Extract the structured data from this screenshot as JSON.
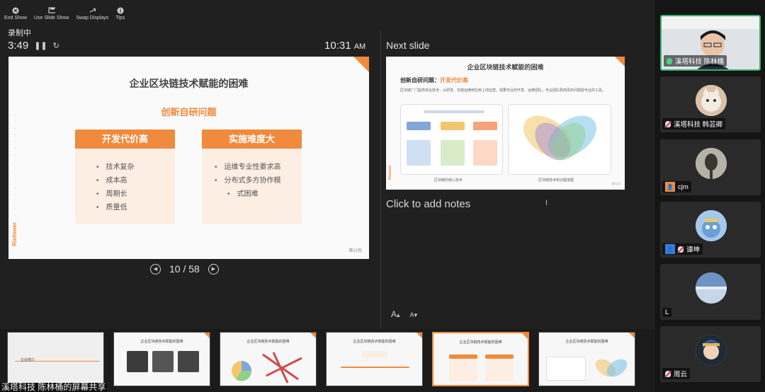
{
  "toolbar": {
    "items": [
      {
        "label": "End Show",
        "icon": "close-circle-icon"
      },
      {
        "label": "Use Slide Show",
        "icon": "screen-icon"
      },
      {
        "label": "Swap Displays",
        "icon": "swap-icon"
      },
      {
        "label": "Tips",
        "icon": "info-icon"
      }
    ]
  },
  "status": {
    "recording": "录制中",
    "elapsed": "3:49",
    "clock_time": "10:31",
    "clock_ampm": "AM"
  },
  "current_slide": {
    "title": "企业区块链技术赋能的困难",
    "subtitle": "创新自研问题",
    "cards": [
      {
        "header": "开发代价高",
        "items": [
          "技术复杂",
          "成本高",
          "周期长",
          "质量低"
        ]
      },
      {
        "header": "实施难度大",
        "items": [
          "运维专业性要求高",
          "分布式多方协作模",
          "式困难"
        ]
      }
    ],
    "brand": "Riefower",
    "page_label": "第10页"
  },
  "navigation": {
    "position": "10 / 58"
  },
  "next_slide": {
    "label": "Next slide",
    "title": "企业区块链技术赋能的困难",
    "question_prefix": "创新自研问题：",
    "question_highlight": "开发代价高",
    "description": "区块链厂门提供综合技术，从研发、实施运维到应用上线运营，需要专业的开发、运维团队，专业团队费用贵的问题需专业的工具。",
    "caption_left": "区块链的核心技术",
    "caption_right": "区块链技术知识图谱图",
    "brand": "Riefower",
    "page_label": "第11页"
  },
  "notes": {
    "placeholder": "Click to add notes"
  },
  "font_controls": {
    "increase": "A",
    "decrease": "A"
  },
  "thumbnails": [
    {
      "title": "企业简介"
    },
    {
      "title": "企业区块链技术赋能的困难"
    },
    {
      "title": "企业区块链技术赋能的困难"
    },
    {
      "title": "企业区块链技术赋能的困难"
    },
    {
      "title": "企业区块链技术赋能的困难"
    },
    {
      "title": "企业区块链技术赋能的困难"
    }
  ],
  "share_banner": "溪塔科技 陈林桶的屏幕共享",
  "participants": [
    {
      "name": "溪塔科技 陈林桶",
      "mic": "on",
      "speaking": true
    },
    {
      "name": "溪塔科技 韩芸卿",
      "mic": "muted"
    },
    {
      "name": "cjm",
      "mic": "none"
    },
    {
      "name": "谭坤",
      "mic": "muted"
    },
    {
      "name": "L",
      "mic": "none"
    },
    {
      "name": "周云",
      "mic": "muted"
    }
  ],
  "colors": {
    "accent": "#f08a3c",
    "speaking": "#35b36a",
    "background": "#202020"
  }
}
